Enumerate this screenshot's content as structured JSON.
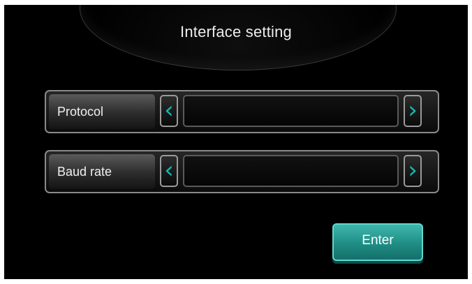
{
  "title": "Interface setting",
  "rows": [
    {
      "label": "Protocol",
      "value": ""
    },
    {
      "label": "Baud rate",
      "value": ""
    }
  ],
  "arrows": {
    "prev": "‹",
    "next": "›"
  },
  "enter_label": "Enter",
  "colors": {
    "background": "#000000",
    "accent": "#1fa39a",
    "arrow": "#18b8b0",
    "frame": "#8a8a8a"
  },
  "icons": {
    "prev": "chevron-left-icon",
    "next": "chevron-right-icon"
  }
}
